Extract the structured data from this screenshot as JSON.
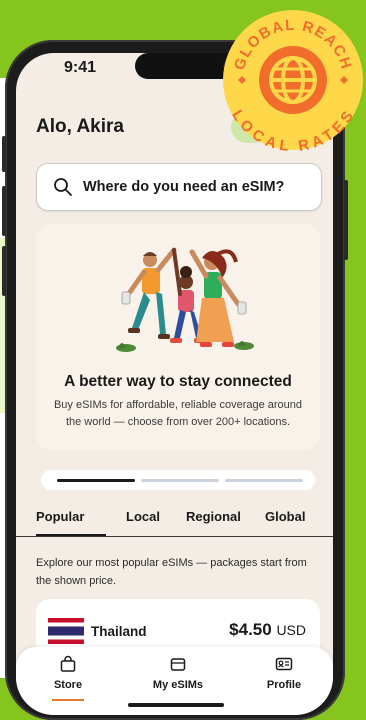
{
  "status_bar": {
    "time": "9:41"
  },
  "header": {
    "greeting": "Alo, Akira"
  },
  "search": {
    "placeholder": "Where do you need an eSIM?"
  },
  "hero": {
    "title": "A better way to stay connected",
    "subtitle": "Buy eSIMs for affordable, reliable coverage around the world — choose from over 200+ locations."
  },
  "tabs": [
    {
      "label": "Popular",
      "active": true
    },
    {
      "label": "Local",
      "active": false
    },
    {
      "label": "Regional",
      "active": false
    },
    {
      "label": "Global",
      "active": false
    }
  ],
  "explore_text": "Explore our most popular eSIMs — packages start from the shown price.",
  "destinations": [
    {
      "country": "Thailand",
      "price": "$4.50",
      "currency": "USD",
      "flag_icon": "thailand-flag-icon"
    }
  ],
  "bottom_nav": [
    {
      "label": "Store",
      "icon": "bag-icon",
      "active": true
    },
    {
      "label": "My eSIMs",
      "icon": "sim-card-icon",
      "active": false
    },
    {
      "label": "Profile",
      "icon": "id-card-icon",
      "active": false
    }
  ],
  "badge": {
    "top_text": "GLOBAL REACH",
    "bottom_text": "LOCAL RATES",
    "icon": "globe-icon"
  },
  "colors": {
    "background": "#86c41e",
    "screen": "#f3ede6",
    "accent_orange": "#e8772e",
    "badge_yellow": "#ffd84a",
    "badge_orange": "#f26d2c"
  }
}
